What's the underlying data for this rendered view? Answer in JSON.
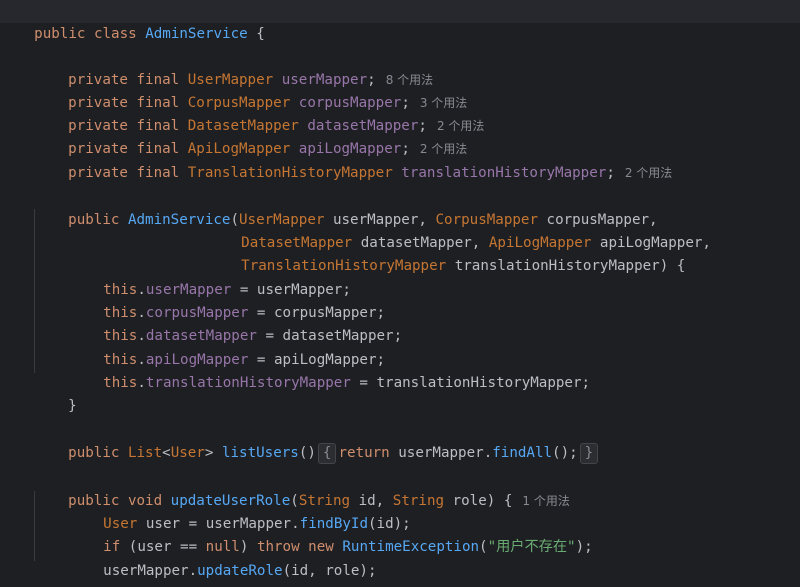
{
  "code": {
    "l1": {
      "kw1": "public class ",
      "cls": "AdminService",
      "rest": " {"
    },
    "l3": {
      "kw": "private final ",
      "type": "UserMapper",
      "var": " userMapper",
      "end": ";",
      "hint": "8 个用法"
    },
    "l4": {
      "kw": "private final ",
      "type": "CorpusMapper",
      "var": " corpusMapper",
      "end": ";",
      "hint": "3 个用法"
    },
    "l5": {
      "kw": "private final ",
      "type": "DatasetMapper",
      "var": " datasetMapper",
      "end": ";",
      "hint": "2 个用法"
    },
    "l6": {
      "kw": "private final ",
      "type": "ApiLogMapper",
      "var": " apiLogMapper",
      "end": ";",
      "hint": "2 个用法"
    },
    "l7": {
      "kw": "private final ",
      "type": "TranslationHistoryMapper",
      "var": " translationHistoryMapper",
      "end": ";",
      "hint": "2 个用法"
    },
    "l9": {
      "kw": "public ",
      "cls": "AdminService",
      "p1": "(",
      "t1": "UserMapper",
      "v1": " userMapper, ",
      "t2": "CorpusMapper",
      "v2": " corpusMapper,"
    },
    "l10": {
      "t1": "DatasetMapper",
      "v1": " datasetMapper, ",
      "t2": "ApiLogMapper",
      "v2": " apiLogMapper,"
    },
    "l11": {
      "t1": "TranslationHistoryMapper",
      "v1": " translationHistoryMapper) {"
    },
    "l12": {
      "this": "this",
      "dot": ".",
      "field": "userMapper",
      "rest": " = userMapper;"
    },
    "l13": {
      "this": "this",
      "dot": ".",
      "field": "corpusMapper",
      "rest": " = corpusMapper;"
    },
    "l14": {
      "this": "this",
      "dot": ".",
      "field": "datasetMapper",
      "rest": " = datasetMapper;"
    },
    "l15": {
      "this": "this",
      "dot": ".",
      "field": "apiLogMapper",
      "rest": " = apiLogMapper;"
    },
    "l16": {
      "this": "this",
      "dot": ".",
      "field": "translationHistoryMapper",
      "rest": " = translationHistoryMapper;"
    },
    "l17": {
      "brace": "}"
    },
    "l19": {
      "kw": "public ",
      "type": "List",
      "lt": "<",
      "t2": "User",
      "gt": "> ",
      "fn": "listUsers",
      "p": "()",
      "fold1": "{",
      "ret": "return ",
      "obj": "userMapper",
      "dot": ".",
      "call": "findAll",
      "end": "();",
      "fold2": "}"
    },
    "l21": {
      "kw": "public void ",
      "fn": "updateUserRole",
      "p1": "(",
      "t1": "String",
      "v1": " id, ",
      "t2": "String",
      "v2": " role) {",
      "hint": "1 个用法"
    },
    "l22": {
      "type": "User",
      "v": " user = ",
      "obj": "userMapper",
      "dot": ".",
      "call": "findById",
      "end": "(id);"
    },
    "l23": {
      "kw": "if ",
      "p": "(user == ",
      "null": "null",
      "p2": ") ",
      "throw": "throw new ",
      "ex": "RuntimeException",
      "s1": "(",
      "str": "\"用户不存在\"",
      "s2": ");"
    },
    "l24": {
      "obj": "userMapper",
      "dot": ".",
      "call": "updateRole",
      "end": "(id, role);"
    },
    "l25": {
      "brace": "}"
    }
  }
}
